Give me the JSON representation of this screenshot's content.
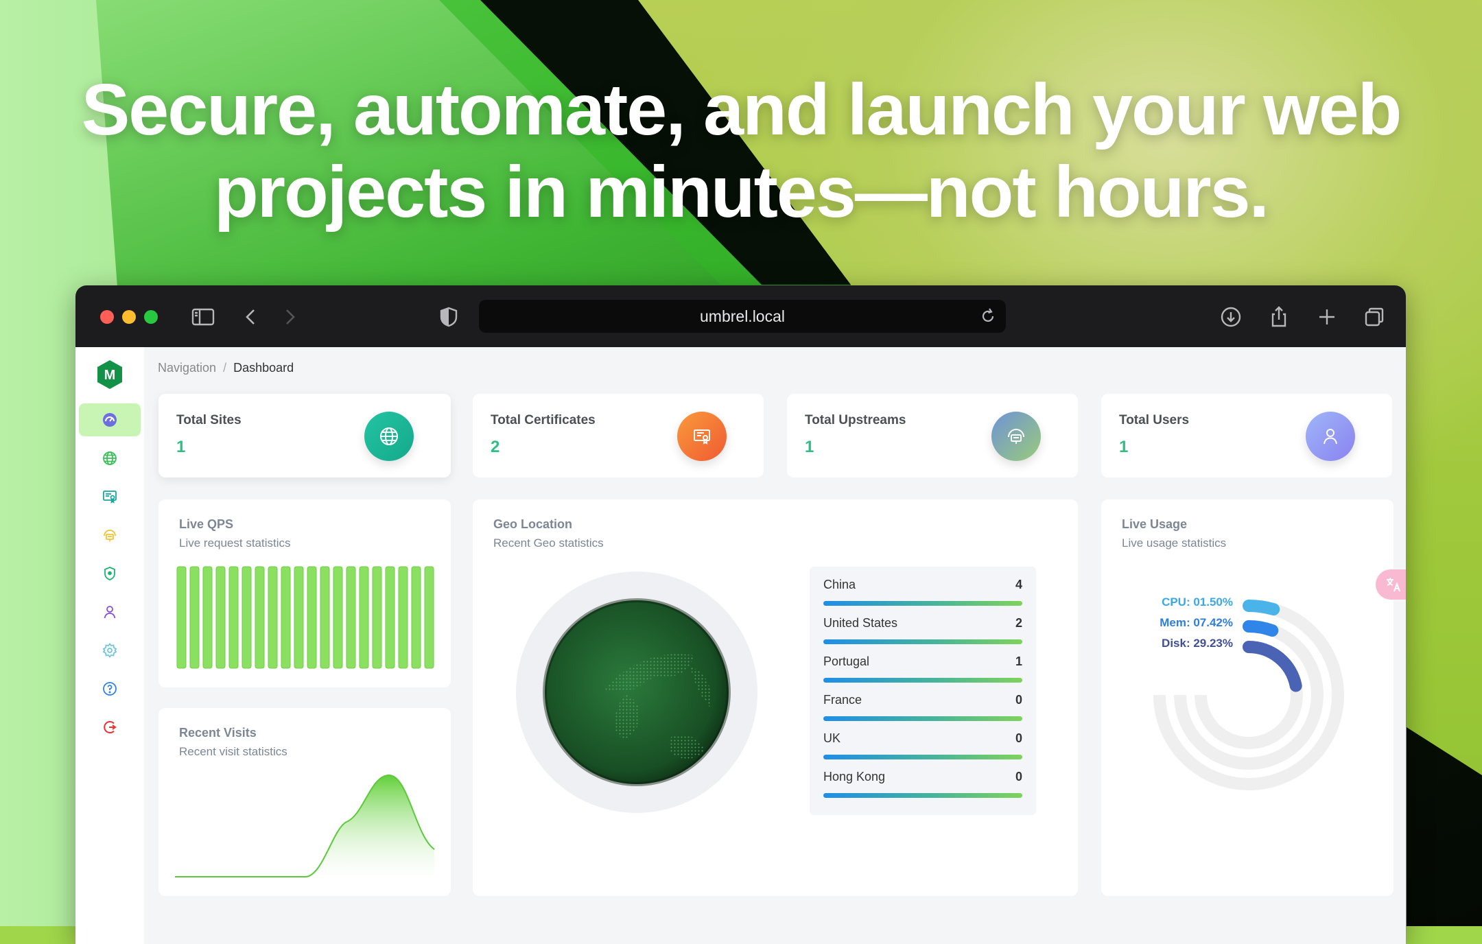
{
  "headline": {
    "line1": "Secure, automate, and launch your web",
    "line2": "projects in minutes—not hours."
  },
  "browser": {
    "url": "umbrel.local"
  },
  "breadcrumb": {
    "root": "Navigation",
    "separator": "/",
    "current": "Dashboard"
  },
  "sidebar": {
    "logo_letter": "M",
    "items": [
      {
        "icon": "dashboard-icon",
        "active": true
      },
      {
        "icon": "globe-icon",
        "active": false
      },
      {
        "icon": "certificate-icon",
        "active": false
      },
      {
        "icon": "upstream-icon",
        "active": false
      },
      {
        "icon": "shield-icon",
        "active": false
      },
      {
        "icon": "user-icon",
        "active": false
      },
      {
        "icon": "settings-icon",
        "active": false
      },
      {
        "icon": "help-icon",
        "active": false
      },
      {
        "icon": "logout-icon",
        "active": false
      }
    ]
  },
  "stats": [
    {
      "label": "Total Sites",
      "value": "1",
      "icon": "globe-icon",
      "color": "#1fb89a"
    },
    {
      "label": "Total Certificates",
      "value": "2",
      "icon": "certificate-icon",
      "color": "#f5763a"
    },
    {
      "label": "Total Upstreams",
      "value": "1",
      "icon": "upstream-icon",
      "color": "#7fa8c4"
    },
    {
      "label": "Total Users",
      "value": "1",
      "icon": "user-icon",
      "color": "#8f9cf5"
    }
  ],
  "live_qps": {
    "title": "Live QPS",
    "subtitle": "Live request statistics"
  },
  "recent_visits": {
    "title": "Recent Visits",
    "subtitle": "Recent visit statistics"
  },
  "geo": {
    "title": "Geo Location",
    "subtitle": "Recent Geo statistics",
    "rows": [
      {
        "name": "China",
        "count": "4"
      },
      {
        "name": "United States",
        "count": "2"
      },
      {
        "name": "Portugal",
        "count": "1"
      },
      {
        "name": "France",
        "count": "0"
      },
      {
        "name": "UK",
        "count": "0"
      },
      {
        "name": "Hong Kong",
        "count": "0"
      }
    ]
  },
  "usage": {
    "title": "Live Usage",
    "subtitle": "Live usage statistics",
    "cpu": "CPU: 01.50%",
    "mem": "Mem: 07.42%",
    "disk": "Disk: 29.23%",
    "cpu_value": 1.5,
    "mem_value": 7.42,
    "disk_value": 29.23,
    "colors": {
      "cpu": "#4ab3ea",
      "mem": "#2f86e8",
      "disk": "#4b63b5"
    }
  }
}
